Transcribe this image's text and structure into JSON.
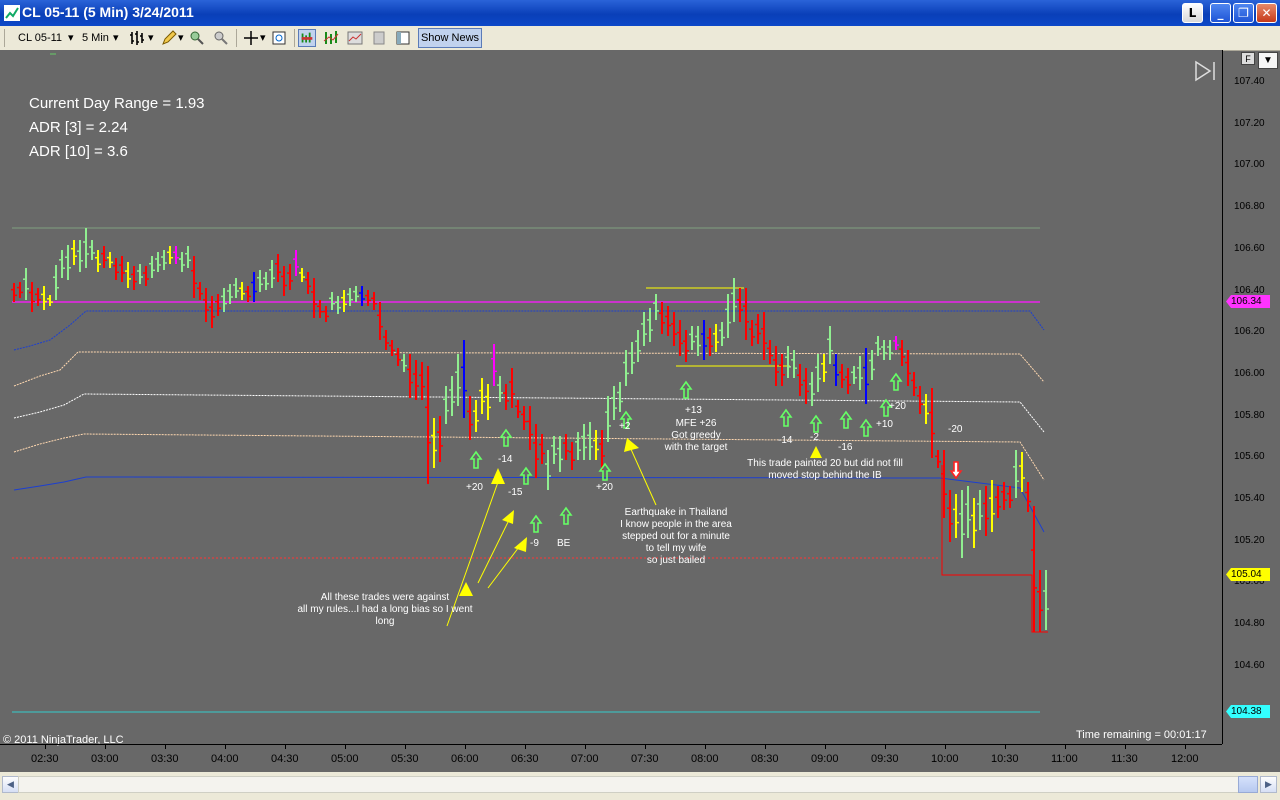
{
  "window": {
    "title": "CL 05-11 (5 Min)  3/24/2011",
    "buttons": {
      "l": "L",
      "minimize": "_",
      "maximize": "❐",
      "close": "✕"
    }
  },
  "toolbar": {
    "instrument": "CL 05-11",
    "interval": "5 Min",
    "show_news": "Show News"
  },
  "chart_panel": {
    "f_button": "F",
    "range_text": "Current Day Range = 1.93",
    "adr3_text": "ADR [3] = 2.24",
    "adr10_text": "ADR [10] = 3.6",
    "copyright": "© 2011 NinjaTrader, LLC",
    "time_remaining": "Time remaining = 00:01:17"
  },
  "price_axis": {
    "labels": [
      "107.40",
      "107.20",
      "107.00",
      "106.80",
      "106.60",
      "106.40",
      "106.20",
      "106.00",
      "105.80",
      "105.60",
      "105.40",
      "105.20",
      "105.00",
      "104.80",
      "104.60"
    ],
    "tags": [
      {
        "value": "106.34",
        "bg": "#ff33ff"
      },
      {
        "value": "105.04",
        "bg": "#ffff00"
      },
      {
        "value": "104.38",
        "bg": "#33ffff"
      }
    ]
  },
  "time_axis": {
    "labels": [
      "02:30",
      "03:00",
      "03:30",
      "04:00",
      "04:30",
      "05:00",
      "05:30",
      "06:00",
      "06:30",
      "07:00",
      "07:30",
      "08:00",
      "08:30",
      "09:00",
      "09:30",
      "10:00",
      "10:30",
      "11:00",
      "11:30",
      "12:00"
    ]
  },
  "annotations": {
    "trade_labels": [
      "+20",
      "-14",
      "-15",
      "-9",
      "BE",
      "+20",
      "+2",
      "+13",
      "-14",
      "-2",
      "-16",
      "+10",
      "+20",
      "-20"
    ],
    "note1": [
      "All these trades were against",
      "all my rules...I had a long bias so I went",
      "long"
    ],
    "note2": [
      "Earthquake in Thailand",
      "I know people in the area",
      "stepped out for a minute",
      "to tell my wife",
      "so just bailed"
    ],
    "note3": [
      "MFE +26",
      "Got greedy",
      "with the target"
    ],
    "note4": [
      "This trade painted 20 but did not fill",
      "moved stop behind the IB"
    ]
  },
  "colors": {
    "background": "#686868",
    "up_bar": "#90ee90",
    "down_bar": "#ff0000",
    "neutral_bar": "#ffff00",
    "blue_bar": "#0000ff",
    "magenta_bar": "#ff00ff",
    "band_line": "#ffd8b0",
    "cyan_line": "#33ffff"
  }
}
